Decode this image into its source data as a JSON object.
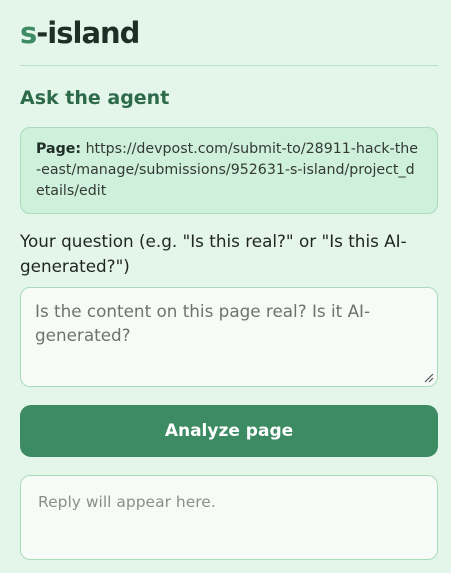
{
  "brand": {
    "accent_text": "s",
    "rest_text": "-island"
  },
  "section": {
    "title": "Ask the agent"
  },
  "page_info": {
    "label": "Page:",
    "url": "https://devpost.com/submit-to/28911-hack-the-east/manage/submissions/952631-s-island/project_details/edit"
  },
  "question": {
    "label": "Your question (e.g. \"Is this real?\" or \"Is this AI-generated?\")",
    "value": "",
    "placeholder": "Is the content on this page real? Is it AI-generated?"
  },
  "analyze_button": {
    "label": "Analyze page"
  },
  "reply": {
    "placeholder": "Reply will appear here."
  },
  "colors": {
    "background": "#e4f6ea",
    "accent": "#3d8b63",
    "heading": "#2d6a49",
    "page_box_bg": "#cff0da",
    "border": "#a9dcbb"
  },
  "icons": {
    "resize": "resize-grip-icon"
  }
}
